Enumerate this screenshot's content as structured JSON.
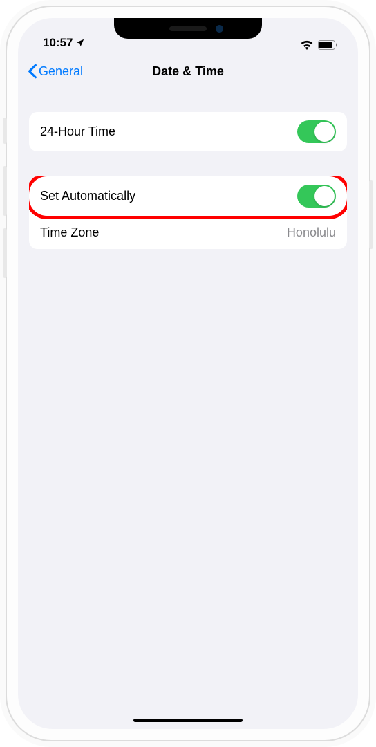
{
  "status": {
    "time": "10:57",
    "location_icon": "location-arrow"
  },
  "nav": {
    "back_label": "General",
    "title": "Date & Time"
  },
  "group1": {
    "row24h": {
      "label": "24-Hour Time",
      "toggle_on": true
    }
  },
  "group2": {
    "rowSetAuto": {
      "label": "Set Automatically",
      "toggle_on": true,
      "highlighted": true
    },
    "rowTimeZone": {
      "label": "Time Zone",
      "value": "Honolulu"
    }
  }
}
